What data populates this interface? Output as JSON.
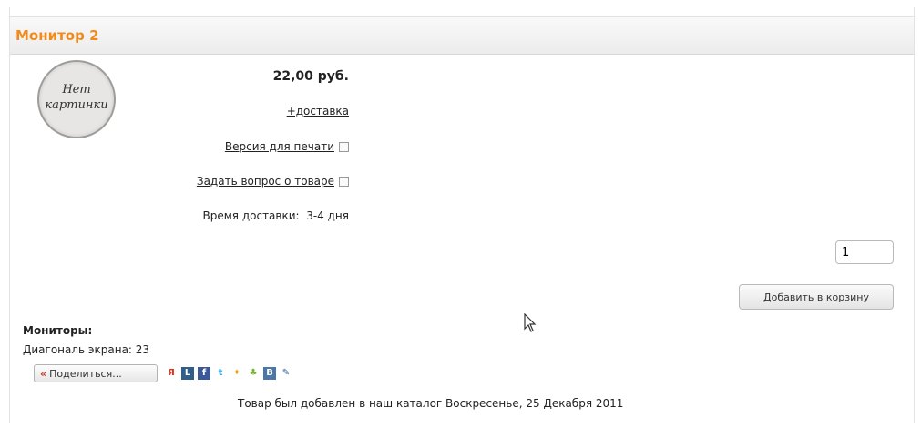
{
  "product": {
    "title": "Монитор 2",
    "no_image_text": [
      "Нет",
      "картинки"
    ],
    "price": "22,00 руб.",
    "delivery_link": "+доставка",
    "print_link": "Версия для печати",
    "ask_link": "Задать вопрос о товаре",
    "delivery_time_label": "Время доставки:",
    "delivery_time_value": "3-4 дня"
  },
  "cart": {
    "quantity": "1",
    "add_button_label": "Добавить в корзину"
  },
  "specs": {
    "category": "Мониторы:",
    "diagonal": "Диагональ экрана: 23"
  },
  "share": {
    "button_label": "Поделиться...",
    "arrow_glyph": "«",
    "icons": [
      "yandex-icon",
      "livejournal-icon",
      "facebook-icon",
      "twitter-icon",
      "moikrug-icon",
      "odnoklassniki-icon",
      "vkontakte-icon",
      "bookmark-icon"
    ]
  },
  "footer": {
    "added_text": "Товар был добавлен в наш каталог Воскресенье, 25 Декабря 2011"
  },
  "colors": {
    "title": "#f08a1c",
    "share_arrow": "#d2321e"
  }
}
